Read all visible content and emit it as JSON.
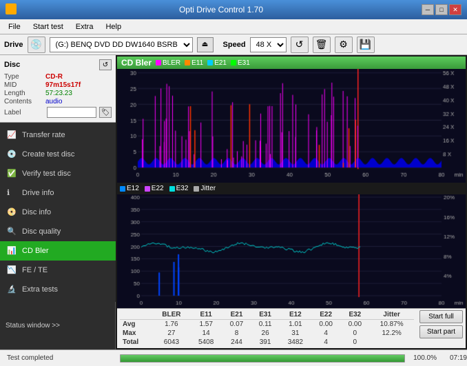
{
  "titleBar": {
    "title": "Opti Drive Control 1.70",
    "minBtn": "─",
    "maxBtn": "□",
    "closeBtn": "✕"
  },
  "menuBar": {
    "items": [
      "File",
      "Start test",
      "Extra",
      "Help"
    ]
  },
  "driveBar": {
    "driveLabel": "Drive",
    "driveValue": "(G:)  BENQ DVD DD DW1640 BSRB",
    "speedLabel": "Speed",
    "speedValue": "48 X"
  },
  "discPanel": {
    "title": "Disc",
    "typeLabel": "Type",
    "typeValue": "CD-R",
    "midLabel": "MID",
    "midValue": "97m15s17f",
    "lengthLabel": "Length",
    "lengthValue": "57:23.23",
    "contentsLabel": "Contents",
    "contentsValue": "audio",
    "labelLabel": "Label"
  },
  "navItems": [
    {
      "id": "transfer-rate",
      "label": "Transfer rate",
      "icon": "📈"
    },
    {
      "id": "create-test-disc",
      "label": "Create test disc",
      "icon": "💿"
    },
    {
      "id": "verify-test-disc",
      "label": "Verify test disc",
      "icon": "✅"
    },
    {
      "id": "drive-info",
      "label": "Drive info",
      "icon": "ℹ️"
    },
    {
      "id": "disc-info",
      "label": "Disc info",
      "icon": "📀"
    },
    {
      "id": "disc-quality",
      "label": "Disc quality",
      "icon": "🔍"
    },
    {
      "id": "cd-bler",
      "label": "CD Bler",
      "icon": "📊",
      "active": true
    },
    {
      "id": "fe-te",
      "label": "FE / TE",
      "icon": "📉"
    },
    {
      "id": "extra-tests",
      "label": "Extra tests",
      "icon": "🔬"
    }
  ],
  "statusWindow": {
    "label": "Status window >>",
    "text": "Test completed",
    "progress": 100.0,
    "progressText": "100.0%",
    "time": "07:19"
  },
  "chart": {
    "title": "CD Bler",
    "legend1": [
      "BLER",
      "E11",
      "E21",
      "E31"
    ],
    "legend2": [
      "E12",
      "E22",
      "E32",
      "Jitter"
    ],
    "colors1": [
      "#ff00ff",
      "#ff6600",
      "#00ccff",
      "#00ff00"
    ],
    "colors2": [
      "#0088ff",
      "#9900ff",
      "#00ffff",
      "#aaaaaa"
    ],
    "statsHeaders": [
      "",
      "BLER",
      "E11",
      "E21",
      "E31",
      "E12",
      "E22",
      "E32",
      "Jitter"
    ],
    "statsRows": [
      {
        "label": "Avg",
        "values": [
          "1.76",
          "1.57",
          "0.07",
          "0.11",
          "1.01",
          "0.00",
          "0.00",
          "10.87%"
        ]
      },
      {
        "label": "Max",
        "values": [
          "27",
          "14",
          "8",
          "26",
          "31",
          "4",
          "0",
          "12.2%"
        ]
      },
      {
        "label": "Total",
        "values": [
          "6043",
          "5408",
          "244",
          "391",
          "3482",
          "4",
          "0",
          ""
        ]
      }
    ],
    "startFullLabel": "Start full",
    "startPartLabel": "Start part"
  }
}
